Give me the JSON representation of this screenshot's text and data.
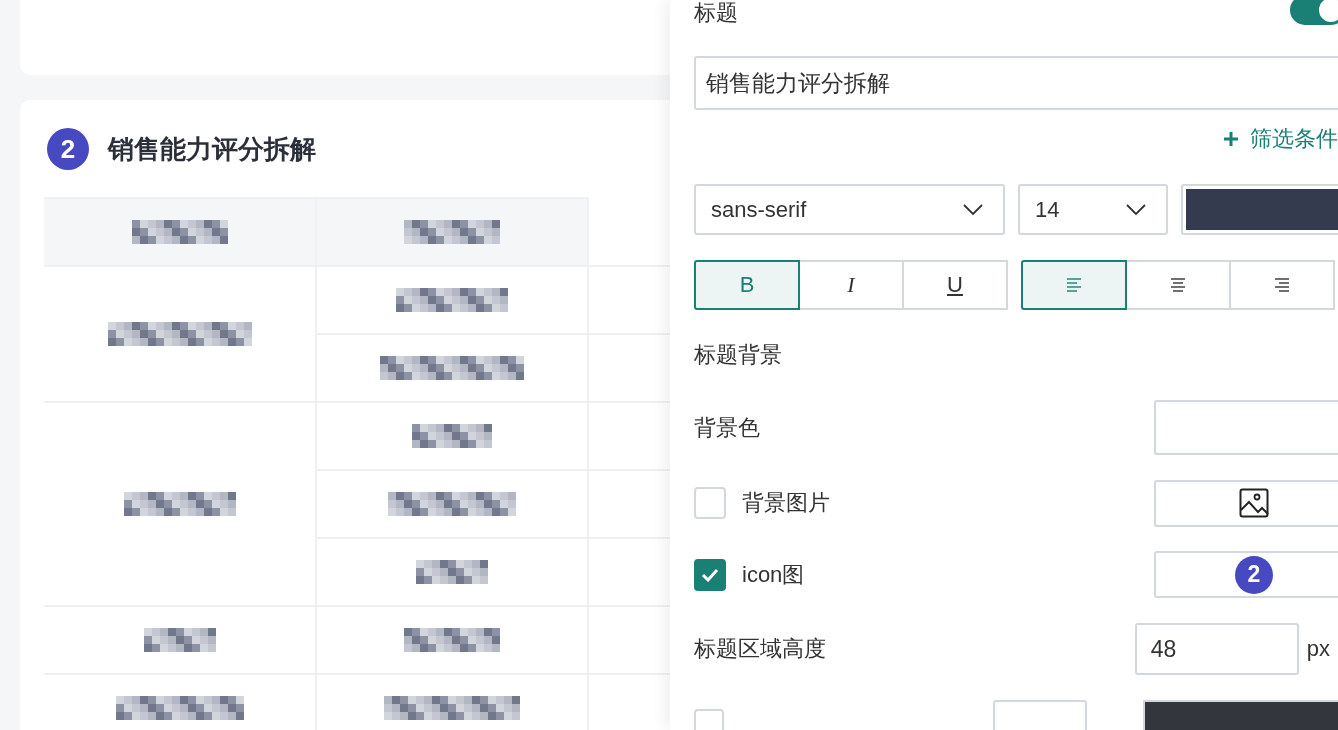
{
  "dashboard": {
    "section": {
      "badge": "2",
      "title": "销售能力评分拆解",
      "table": {
        "header": [
          {
            "kind": "redacted"
          },
          {
            "kind": "redacted"
          }
        ],
        "groups": [
          {
            "cell_1": {
              "kind": "redacted"
            },
            "rows": [
              {
                "cell_2": {
                  "kind": "redacted"
                }
              },
              {
                "cell_2": {
                  "kind": "redacted"
                }
              }
            ]
          },
          {
            "cell_1": {
              "kind": "redacted"
            },
            "rows": [
              {
                "cell_2": {
                  "kind": "redacted"
                }
              },
              {
                "cell_2": {
                  "kind": "redacted"
                }
              },
              {
                "cell_2": {
                  "kind": "redacted"
                }
              }
            ]
          },
          {
            "cell_1": {
              "kind": "redacted"
            },
            "rows": [
              {
                "cell_2": {
                  "kind": "redacted"
                }
              }
            ]
          },
          {
            "cell_1": {
              "kind": "redacted"
            },
            "rows": [
              {
                "cell_2": {
                  "kind": "redacted"
                }
              }
            ]
          }
        ]
      }
    }
  },
  "panel": {
    "title_label": "标题",
    "title_toggle": {
      "on": true
    },
    "title_input": {
      "value": "销售能力评分拆解"
    },
    "add_filter": {
      "label": "筛选条件"
    },
    "font_family": {
      "value": "sans-serif"
    },
    "font_size": {
      "value": "14"
    },
    "font_color": {
      "color": "#343b4f"
    },
    "text_styles": [
      {
        "label": "B",
        "kind": "bold",
        "selected": true
      },
      {
        "label": "I",
        "kind": "italic",
        "selected": false
      },
      {
        "label": "U",
        "kind": "underline",
        "selected": false
      }
    ],
    "alignments": [
      {
        "kind": "left",
        "selected": true
      },
      {
        "kind": "center",
        "selected": false
      },
      {
        "kind": "right",
        "selected": false
      }
    ],
    "background_section": "标题背景",
    "background_color": {
      "label": "背景色"
    },
    "background_image": {
      "label": "背景图片",
      "checked": false
    },
    "icon_image": {
      "label": "icon图",
      "checked": true,
      "badge": "2"
    },
    "title_height": {
      "label": "标题区域高度",
      "value": "48",
      "unit": "px"
    },
    "top_border": {
      "checked": false,
      "color": "#33363d"
    }
  }
}
